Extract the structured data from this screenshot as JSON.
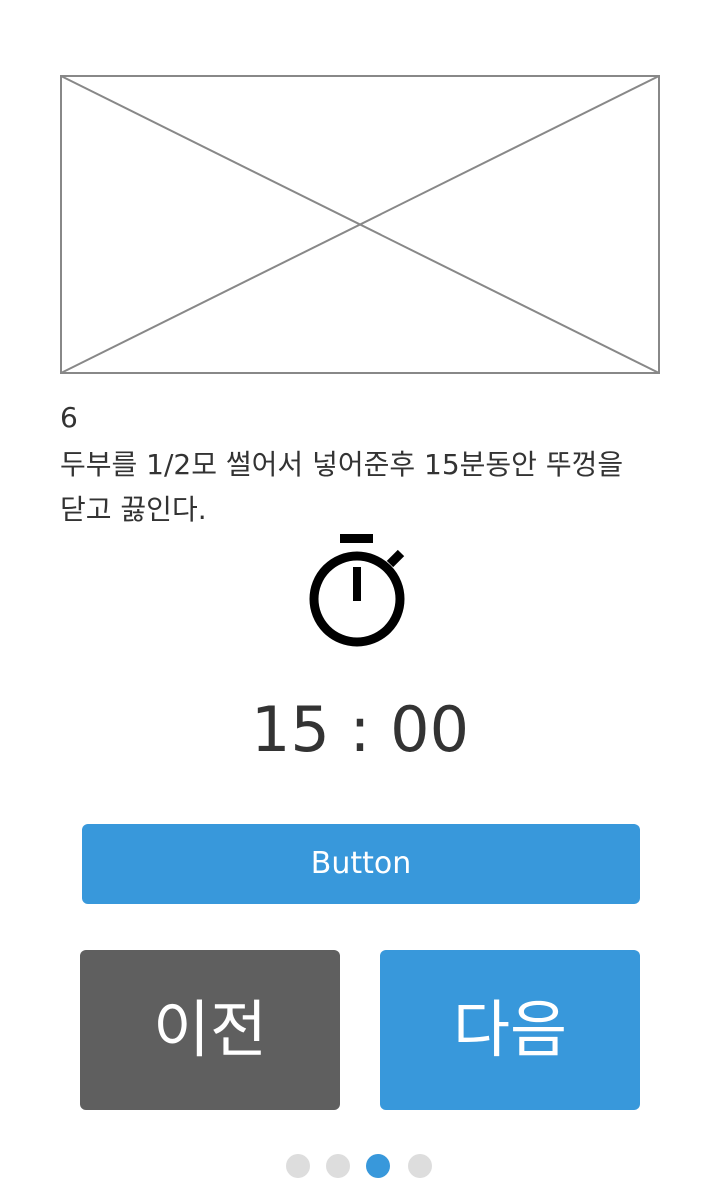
{
  "step": {
    "number": "6",
    "description": "두부를 1/2모 썰어서 넣어준후 15분동안 뚜껑을 닫고 끓인다."
  },
  "timer": {
    "display": "15 : 00",
    "icon": "stopwatch-icon"
  },
  "buttons": {
    "main_label": "Button",
    "prev_label": "이전",
    "next_label": "다음"
  },
  "pager": {
    "total": 4,
    "current": 3
  },
  "colors": {
    "accent": "#3898db",
    "secondary": "#5f5f5f",
    "dot_inactive": "#dddddd",
    "text": "#333333",
    "placeholder_stroke": "#888888"
  }
}
